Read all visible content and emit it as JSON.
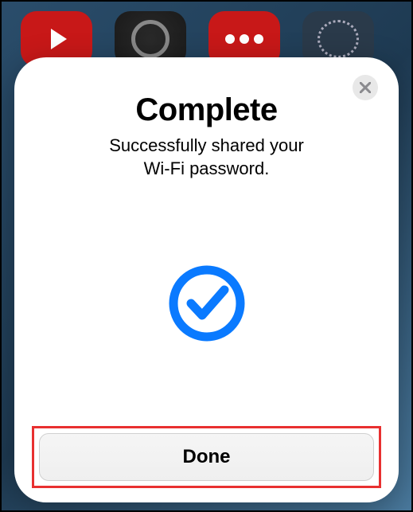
{
  "modal": {
    "title": "Complete",
    "subtitle_line1": "Successfully shared your",
    "subtitle_line2": "Wi-Fi password.",
    "done_label": "Done"
  },
  "icons": {
    "close": "close-icon",
    "checkmark": "checkmark-circle-icon"
  },
  "colors": {
    "accent_blue": "#0a7aff",
    "highlight_red": "#e83030"
  }
}
